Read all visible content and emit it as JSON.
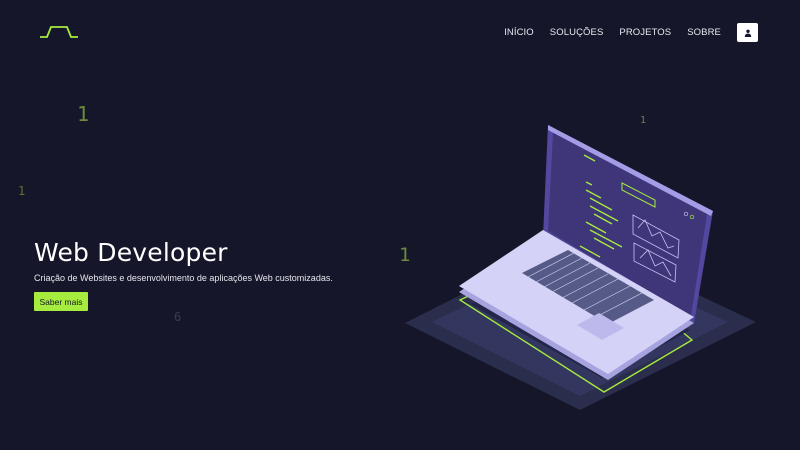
{
  "brand": {
    "logo_icon": "jnl-wordmark-logo",
    "accent_color": "#a6ec3e",
    "background_color": "#151629"
  },
  "nav": {
    "items": [
      {
        "label": "INÍCIO"
      },
      {
        "label": "SOLUÇÕES"
      },
      {
        "label": "PROJETOS"
      },
      {
        "label": "SOBRE"
      }
    ],
    "user_icon": "user-icon"
  },
  "hero": {
    "title": "Web Developer",
    "subtitle": "Criação de Websites e desenvolvimento de aplicações Web customizadas.",
    "cta_label": "Saber mais"
  },
  "background_digits": [
    "1",
    "1",
    "1",
    "1",
    "6"
  ],
  "illustration": {
    "icon": "isometric-laptop-illustration"
  }
}
